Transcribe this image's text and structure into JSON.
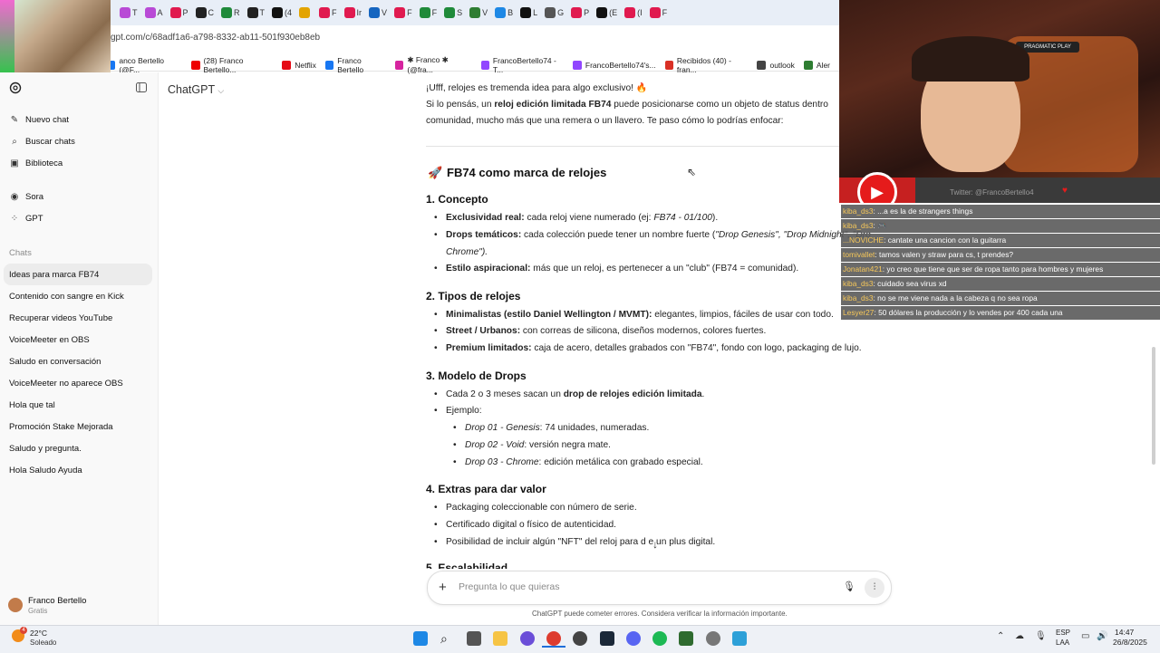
{
  "browser": {
    "tabs": [
      "T",
      "A",
      "P",
      "C",
      "R",
      "T",
      "(4",
      "",
      "F",
      "Ir",
      "V",
      "F",
      "F",
      "S",
      "V",
      "B",
      "L",
      "G",
      "P",
      "(E",
      "(I",
      "F"
    ],
    "url": "gpt.com/c/68adf1a6-a798-8332-ab11-501f930eb8eb",
    "bookmarks": [
      "anco Bertello (@F...",
      "(28) Franco Bertello...",
      "Netflix",
      "Franco Bertello",
      "✱ Franco ✱ (@fra...",
      "FrancoBertello74 - T...",
      "FrancoBertello74's...",
      "Recibidos (40) - fran...",
      "outlook",
      "Aler"
    ]
  },
  "sidebar": {
    "actions": [
      {
        "label": "Nuevo chat",
        "icon": "new-chat-icon"
      },
      {
        "label": "Buscar chats",
        "icon": "search-icon"
      },
      {
        "label": "Biblioteca",
        "icon": "library-icon"
      },
      {
        "label": "Sora",
        "icon": "sora-icon"
      },
      {
        "label": "GPT",
        "icon": "gpt-grid-icon"
      }
    ],
    "section_label": "Chats",
    "chats": [
      "Ideas para marca FB74",
      "Contenido con sangre en Kick",
      "Recuperar videos YouTube",
      "VoiceMeeter en OBS",
      "Saludo en conversación",
      "VoiceMeeter no aparece OBS",
      "Hola que tal",
      "Promoción Stake Mejorada",
      "Saludo y pregunta.",
      "Hola Saludo Ayuda"
    ],
    "user": {
      "name": "Franco Bertello",
      "plan": "Gratis"
    }
  },
  "main": {
    "model": "ChatGPT",
    "intro_1": "¡Ufff, relojes es tremenda idea para algo exclusivo! 🔥",
    "intro_2a": "Si lo pensás, un ",
    "intro_2b": "reloj edición limitada FB74",
    "intro_2c": " puede posicionarse como un objeto de status dentro",
    "intro_3": "comunidad, mucho más que una remera o un llavero. Te paso cómo lo podrías enfocar:",
    "title": "FB74 como marca de relojes",
    "s1": "1. Concepto",
    "s1_items": [
      {
        "b": "Exclusividad real:",
        "t": " cada reloj viene numerado (ej: ",
        "i": "FB74 - 01/100",
        "e": ")."
      },
      {
        "b": "Drops temáticos:",
        "t": " cada colección puede tener un nombre fuerte (",
        "i": "\"Drop Genesis\", \"Drop Midnight\", \"Dro",
        "e": ""
      },
      {
        "b": "Estilo aspiracional:",
        "t": " más que un reloj, es pertenecer a un \"club\" (FB74 = comunidad).",
        "i": "",
        "e": ""
      }
    ],
    "s1_item2_cont": "Chrome\").",
    "s2": "2. Tipos de relojes",
    "s2_items": [
      {
        "b": "Minimalistas (estilo Daniel Wellington / MVMT):",
        "t": " elegantes, limpios, fáciles de usar con todo."
      },
      {
        "b": "Street / Urbanos:",
        "t": " con correas de silicona, diseños modernos, colores fuertes."
      },
      {
        "b": "Premium limitados:",
        "t": " caja de acero, detalles grabados con \"FB74\", fondo con logo, packaging de lujo."
      }
    ],
    "s3": "3. Modelo de Drops",
    "s3_item1a": "Cada 2 o 3 meses sacan un ",
    "s3_item1b": "drop de relojes edición limitada",
    "s3_item1c": ".",
    "s3_item2": "Ejemplo:",
    "s3_sub": [
      {
        "i": "Drop 01 - Genesis",
        "t": ": 74 unidades, numeradas."
      },
      {
        "i": "Drop 02 - Void",
        "t": ": versión negra mate."
      },
      {
        "i": "Drop 03 - Chrome",
        "t": ": edición metálica con grabado especial."
      }
    ],
    "s4": "4. Extras para dar valor",
    "s4_items": [
      "Packaging coleccionable con número de serie.",
      "Certificado digital o físico de autenticidad.",
      "Posibilidad de incluir algún \"NFT\" del reloj para d  e un plus digital."
    ],
    "s5": "5. Escalabilidad",
    "input_placeholder": "Pregunta lo que quieras",
    "disclaimer": "ChatGPT puede cometer errores. Considera verificar la información importante."
  },
  "stream": {
    "twitter": "Twitter: @FrancoBertello4",
    "chat": [
      {
        "user": "kiba_ds3",
        "msg": ": ...a es la de strangers things"
      },
      {
        "user": "kiba_ds3",
        "msg": ": 🎮"
      },
      {
        "user": "...NOVICHE",
        "msg": ": cantate una cancion con la guitarra"
      },
      {
        "user": "tomivallet",
        "msg": ": tamos valen y straw para cs, t prendes?"
      },
      {
        "user": "Jonatan421",
        "msg": ": yo creo que tiene que ser de ropa tanto para hombres y mujeres"
      },
      {
        "user": "kiba_ds3",
        "msg": ": cuidado sea virus xd"
      },
      {
        "user": "kiba_ds3",
        "msg": ": no se me viene nada a la cabeza q no sea ropa"
      },
      {
        "user": "Lesyer27",
        "msg": ": 50 dólares la producción y lo vendes por 400 cada una"
      }
    ]
  },
  "taskbar": {
    "weather_temp": "22°C",
    "weather_desc": "Soleado",
    "weather_badge": "4",
    "lang": "ESP",
    "lang2": "LAA",
    "time": "14:47",
    "date": "26/8/2025"
  }
}
